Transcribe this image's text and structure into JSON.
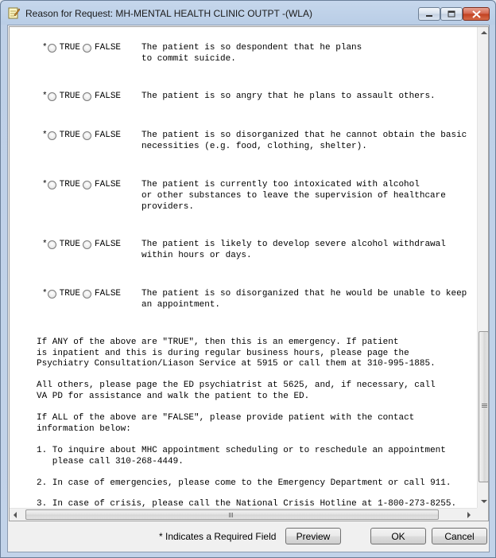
{
  "window": {
    "title": "Reason for Request: MH-MENTAL HEALTH CLINIC OUTPT -(WLA)"
  },
  "icons": {
    "app": "notepad-pencil-icon",
    "minimize": "minimize-icon",
    "maximize": "maximize-icon",
    "close": "close-icon"
  },
  "questions": [
    {
      "star": "*",
      "true_label": "TRUE",
      "false_label": "FALSE",
      "text": "The patient is so despondent that he plans\nto commit suicide."
    },
    {
      "star": "*",
      "true_label": "TRUE",
      "false_label": "FALSE",
      "text": "The patient is so angry that he plans to assault others."
    },
    {
      "star": "*",
      "true_label": "TRUE",
      "false_label": "FALSE",
      "text": "The patient is so disorganized that he cannot obtain the basic\nnecessities (e.g. food, clothing, shelter)."
    },
    {
      "star": "*",
      "true_label": "TRUE",
      "false_label": "FALSE",
      "text": "The patient is currently too intoxicated with alcohol\nor other substances to leave the supervision of healthcare\nproviders."
    },
    {
      "star": "*",
      "true_label": "TRUE",
      "false_label": "FALSE",
      "text": "The patient is likely to develop severe alcohol withdrawal\nwithin hours or days."
    },
    {
      "star": "*",
      "true_label": "TRUE",
      "false_label": "FALSE",
      "text": "The patient is so disorganized that he would be unable to keep\nan appointment."
    }
  ],
  "paragraphs": [
    "If ANY of the above are \"TRUE\", then this is an emergency. If patient\nis inpatient and this is during regular business hours, please page the\nPsychiatry Consultation/Liason Service at 5915 or call them at 310-995-1885.",
    "All others, please page the ED psychiatrist at 5625, and, if necessary, call\nVA PD for assistance and walk the patient to the ED.",
    "If ALL of the above are \"FALSE\", please provide patient with the contact\ninformation below:",
    "1. To inquire about MHC appointment scheduling or to reschedule an appointment\n   please call 310-268-4449.",
    "2. In case of emergencies, please come to the Emergency Department or call 911.",
    "3. In case of crisis, please call the National Crisis Hotline at 1-800-273-8255."
  ],
  "footer": {
    "required_note": "* Indicates a Required Field",
    "preview_label": "Preview",
    "ok_label": "OK",
    "cancel_label": "Cancel"
  }
}
